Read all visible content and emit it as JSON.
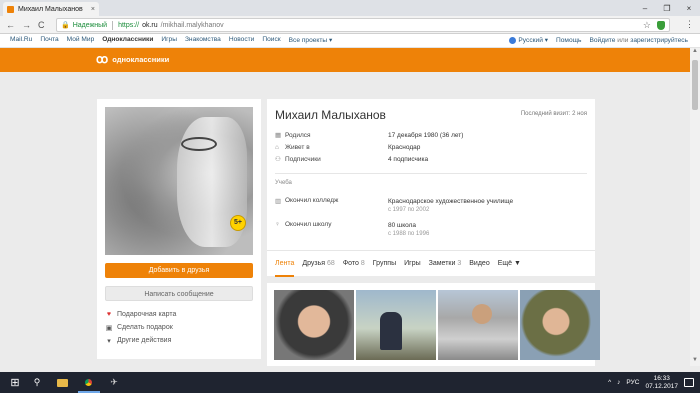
{
  "browser": {
    "tab_title": "Михаил Малыханов",
    "tab_close": "×",
    "win_min": "–",
    "win_max": "❐",
    "win_close": "×",
    "nav_back": "←",
    "nav_forward": "→",
    "nav_reload": "C",
    "secure_label": "Надежный",
    "url_scheme": "https://",
    "url_host": "ok.ru",
    "url_path": "/mikhail.malykhanov",
    "star": "☆",
    "menu": "⋮"
  },
  "portal": {
    "links": [
      "Mail.Ru",
      "Почта",
      "Мой Мир",
      "Одноклассники",
      "Игры",
      "Знакомства",
      "Новости",
      "Поиск",
      "Все проекты ▾"
    ],
    "active_index": 3,
    "language": "Русский ▾",
    "help": "Помощь",
    "login": "Войдите",
    "or": "или",
    "register": "зарегистрируйтесь"
  },
  "header": {
    "logo_mark": "ꝏ",
    "logo_text": "одноклассники"
  },
  "profile": {
    "badge": "5+",
    "add_friend": "Добавить в друзья",
    "send_message": "Написать сообщение",
    "left_menu": [
      {
        "icon": "gift-card-icon",
        "glyph": "♥",
        "label": "Подарочная карта"
      },
      {
        "icon": "gift-icon",
        "glyph": "▣",
        "label": "Сделать подарок"
      },
      {
        "icon": "chevron-down-icon",
        "glyph": "▾",
        "label": "Другие действия"
      }
    ],
    "name": "Михаил Малыханов",
    "last_visit": "Последний визит: 2 ноя",
    "info": [
      {
        "icon": "calendar-icon",
        "glyph": "▦",
        "key": "Родился",
        "value": "17 декабря 1980 (36 лет)"
      },
      {
        "icon": "home-icon",
        "glyph": "⌂",
        "key": "Живет в",
        "value": "Краснодар"
      },
      {
        "icon": "subscribers-icon",
        "glyph": "⚇",
        "key": "Подписчики",
        "value": "4 подписчика"
      }
    ],
    "education_title": "Учеба",
    "education": [
      {
        "icon": "book-icon",
        "glyph": "▥",
        "key": "Окончил колледж",
        "value": "Краснодарское художественное училище",
        "years": "с 1997 по 2002"
      },
      {
        "icon": "school-icon",
        "glyph": "♀",
        "key": "Окончил школу",
        "value": "80 школа",
        "years": "с 1988 по 1996"
      }
    ],
    "tabs": [
      {
        "label": "Лента",
        "count": ""
      },
      {
        "label": "Друзья",
        "count": "68"
      },
      {
        "label": "Фото",
        "count": "8"
      },
      {
        "label": "Группы",
        "count": ""
      },
      {
        "label": "Игры",
        "count": ""
      },
      {
        "label": "Заметки",
        "count": "3"
      },
      {
        "label": "Видео",
        "count": ""
      },
      {
        "label": "Ещё ▼",
        "count": ""
      }
    ]
  },
  "taskbar": {
    "windows_glyph": "⊞",
    "search_glyph": "⚲",
    "app_glyph": "✈",
    "language": "РУС",
    "time": "16:33",
    "date": "07.12.2017",
    "tray_up": "^",
    "tray_glyphs": "♪"
  },
  "colors": {
    "accent": "#ee8208",
    "link": "#2b587a",
    "secure": "#1a8c3a"
  }
}
